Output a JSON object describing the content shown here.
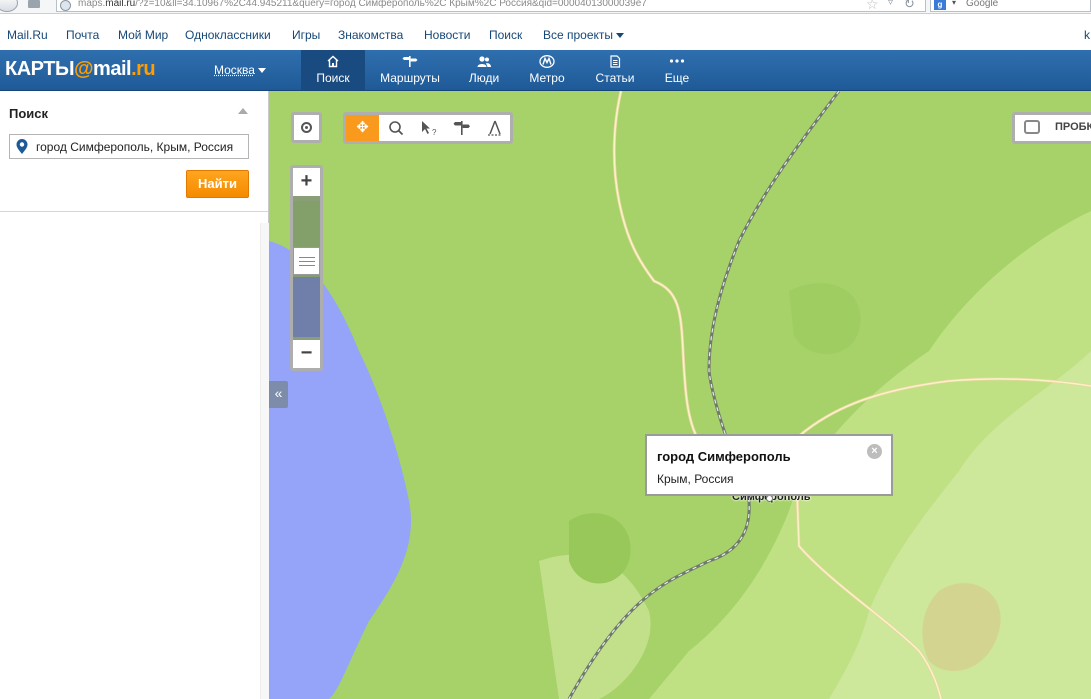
{
  "browser": {
    "url_prefix": "maps.",
    "url_domain": "mail.ru",
    "url_rest": "/?z=10&ll=34.10967%2C44.945211&query=город Симферополь%2C Крым%2C Россия&qid=00004013000039e7",
    "google_search_label": "Google"
  },
  "portal_nav": {
    "items": [
      "Mail.Ru",
      "Почта",
      "Мой Мир",
      "Одноклассники",
      "Игры",
      "Знакомства",
      "Новости",
      "Поиск",
      "Все проекты"
    ],
    "right_letter": "k"
  },
  "header": {
    "logo_text_1": "КАРТЫ",
    "logo_at": "@",
    "logo_mail": "mail",
    "logo_ru": ".ru",
    "city": "Москва",
    "tabs": [
      {
        "label": "Поиск",
        "icon": "home-icon",
        "active": true
      },
      {
        "label": "Маршруты",
        "icon": "signpost-icon",
        "active": false
      },
      {
        "label": "Люди",
        "icon": "people-icon",
        "active": false
      },
      {
        "label": "Метро",
        "icon": "metro-icon",
        "active": false
      },
      {
        "label": "Статьи",
        "icon": "document-icon",
        "active": false
      },
      {
        "label": "Еще",
        "icon": "more-icon",
        "active": false
      }
    ]
  },
  "search_panel": {
    "title": "Поиск",
    "query": "город Симферополь, Крым, Россия",
    "find_label": "Найти"
  },
  "map": {
    "collapse_label": "«",
    "traffic_label": "ПРОБКИ",
    "tools": [
      "move-tool-icon",
      "zoom-search-tool-icon",
      "what-here-tool-icon",
      "route-tool-icon",
      "ruler-tool-icon"
    ],
    "popup": {
      "title": "город Симферополь",
      "subtitle": "Крым, Россия"
    },
    "city_label": "Симферополь",
    "colors": {
      "land": "#a6d269",
      "land_light": "#c6e38a",
      "water": "#95a4f8",
      "road": "#f7ebb6",
      "accent": "#f99a1c",
      "header": "#2f6fae"
    }
  }
}
